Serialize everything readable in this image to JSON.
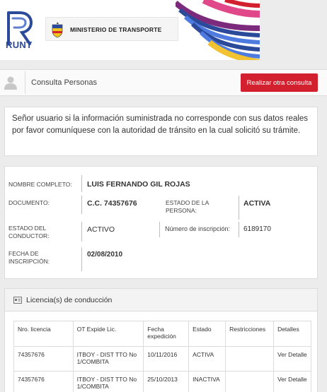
{
  "header": {
    "logo_text": "RUNT",
    "ministry": "MINISTERIO DE TRANSPORTE"
  },
  "toolbar": {
    "title": "Consulta Personas",
    "button_label": "Realizar otra consulta"
  },
  "notice": "Señor usuario si la información suministrada no corresponde con sus datos reales por favor comuníquese con la autoridad de tránsito en la cual solicitó su trámite.",
  "person": {
    "nombre_label": "NOMBRE COMPLETO:",
    "nombre": "LUIS FERNANDO GIL ROJAS",
    "documento_label": "DOCUMENTO:",
    "documento": "C.C. 74357676",
    "estado_persona_label": "ESTADO DE LA PERSONA:",
    "estado_persona": "ACTIVA",
    "estado_conductor_label": "ESTADO DEL CONDUCTOR:",
    "estado_conductor": "ACTIVO",
    "inscripcion_num_label": "Número de inscripción:",
    "inscripcion_num": "6189170",
    "fecha_inscripcion_label": "FECHA DE INSCRIPCIÓN:",
    "fecha_inscripcion": "02/08/2010"
  },
  "licenses": {
    "title": "Licencia(s) de conducción",
    "columns": [
      "Nro. licencia",
      "OT Expide Lic.",
      "Fecha expedición",
      "Estado",
      "Restricciones",
      "Detalles"
    ],
    "rows": [
      {
        "nro": "74357676",
        "ot": "ITBOY - DIST TTO No 1/COMBITA",
        "fecha": "10/11/2016",
        "estado": "ACTIVA",
        "restricciones": "",
        "detalle": "Ver Detalle"
      },
      {
        "nro": "74357676",
        "ot": "ITBOY - DIST TTO No 1/COMBITA",
        "fecha": "25/10/2013",
        "estado": "INACTIVA",
        "restricciones": "",
        "detalle": "Ver Detalle"
      }
    ]
  },
  "colors": {
    "accent": "#d3202e",
    "runt_blue": "#2c4a9a"
  }
}
